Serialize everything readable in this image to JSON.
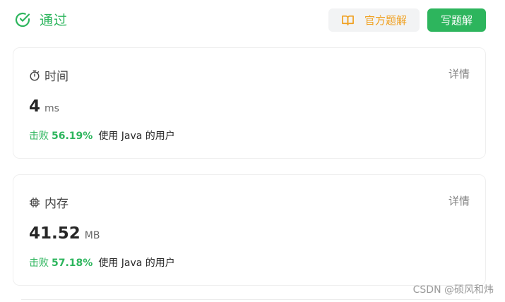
{
  "header": {
    "status": "通过",
    "official_solution_label": "官方题解",
    "write_solution_label": "写题解"
  },
  "time_card": {
    "title": "时间",
    "detail_label": "详情",
    "value": "4",
    "unit": "ms",
    "beats_label": "击败",
    "beats_percent": "56.19%",
    "beats_tail": "使用 Java 的用户"
  },
  "memory_card": {
    "title": "内存",
    "detail_label": "详情",
    "value": "41.52",
    "unit": "MB",
    "beats_label": "击败",
    "beats_percent": "57.18%",
    "beats_tail": "使用 Java 的用户"
  },
  "watermark": "CSDN @硕风和炜",
  "colors": {
    "accent_green": "#2db55d",
    "official_orange": "#f0a020"
  },
  "icons": [
    "check-circle-icon",
    "book-icon",
    "stopwatch-icon",
    "chip-icon"
  ]
}
